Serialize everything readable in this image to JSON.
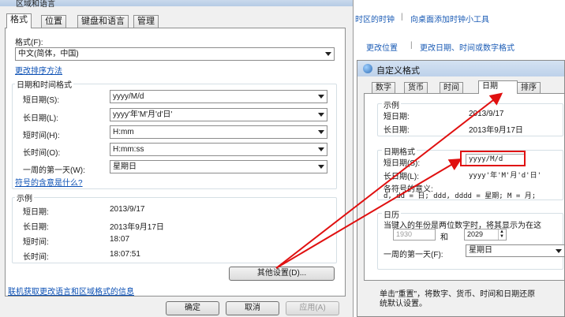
{
  "left_dialog": {
    "title": "区域和语言",
    "tabs": [
      {
        "label": "格式",
        "active": true
      },
      {
        "label": "位置",
        "active": false
      },
      {
        "label": "键盘和语言",
        "active": false
      },
      {
        "label": "管理",
        "active": false
      }
    ],
    "format_label": "格式(F):",
    "format_value": "中文(简体，中国)",
    "sort_link": "更改排序方法",
    "datetime_group": "日期和时间格式",
    "rows": [
      {
        "label": "短日期(S):",
        "value": "yyyy/M/d"
      },
      {
        "label": "长日期(L):",
        "value": "yyyy'年'M'月'd'日'"
      },
      {
        "label": "短时间(H):",
        "value": "H:mm"
      },
      {
        "label": "长时间(O):",
        "value": "H:mm:ss"
      },
      {
        "label": "一周的第一天(W):",
        "value": "星期日"
      }
    ],
    "symbol_link": "符号的含意是什么?",
    "example_group": "示例",
    "examples": [
      {
        "label": "短日期:",
        "value": "2013/9/17"
      },
      {
        "label": "长日期:",
        "value": "2013年9月17日"
      },
      {
        "label": "短时间:",
        "value": "18:07"
      },
      {
        "label": "长时间:",
        "value": "18:07:51"
      }
    ],
    "other_settings": "其他设置(D)...",
    "online_link": "联机获取更改语言和区域格式的信息",
    "ok": "确定",
    "cancel": "取消",
    "apply": "应用(A)"
  },
  "background_panel": {
    "link1": "时区的时钟",
    "separator": "|",
    "link2": "向桌面添加时钟小工具",
    "link3": "更改位置",
    "link4": "更改日期、时间或数字格式"
  },
  "right_dialog": {
    "title": "自定义格式",
    "tabs": [
      {
        "label": "数字",
        "active": false
      },
      {
        "label": "货币",
        "active": false
      },
      {
        "label": "时间",
        "active": false
      },
      {
        "label": "日期",
        "active": true
      },
      {
        "label": "排序",
        "active": false
      }
    ],
    "example_group": "示例",
    "examples": [
      {
        "label": "短日期:",
        "value": "2013/9/17"
      },
      {
        "label": "长日期:",
        "value": "2013年9月17日"
      }
    ],
    "date_format_group": "日期格式",
    "short_date_label": "短日期(S):",
    "short_date_value": "yyyy/M/d",
    "long_date_label": "长日期(L):",
    "long_date_value": "yyyy'年'M'月'd'日'",
    "symbols_label": "各符号的意义:",
    "symbols_text": "d, dd = 日;  ddd, dddd = 星期;  M = 月;",
    "calendar_group": "日历",
    "calendar_text": "当键入的年份是两位数字时，将其显示为在这",
    "year_from": "1930",
    "and": "和",
    "year_to": "2029",
    "first_day_label": "一周的第一天(F):",
    "first_day_value": "星期日",
    "reset_text_line1": "单击\"重置\"，将数字、货币、时间和日期还原",
    "reset_text_line2": "统默认设置。"
  },
  "colors": {
    "highlight": "#e01010",
    "link": "#0a4fb4"
  }
}
